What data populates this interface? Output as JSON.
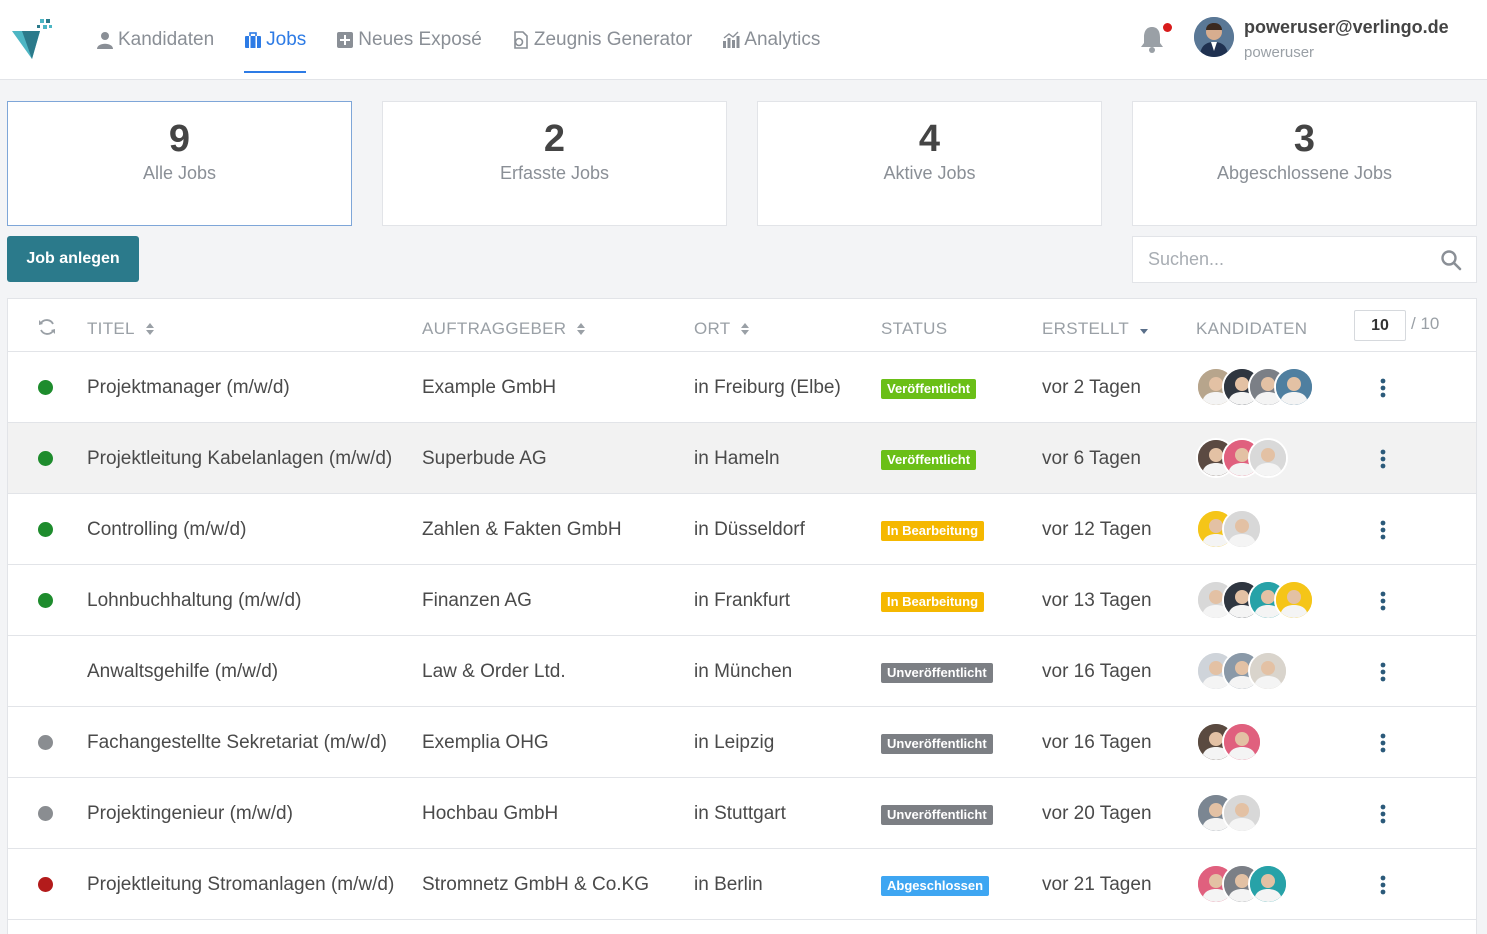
{
  "nav": {
    "items": [
      {
        "label": "Kandidaten",
        "icon": "user-icon",
        "active": false
      },
      {
        "label": "Jobs",
        "icon": "briefcase-icon",
        "active": true
      },
      {
        "label": "Neues Exposé",
        "icon": "plus-square-icon",
        "active": false
      },
      {
        "label": "Zeugnis Generator",
        "icon": "document-gear-icon",
        "active": false
      },
      {
        "label": "Analytics",
        "icon": "analytics-icon",
        "active": false
      }
    ],
    "user": {
      "email": "poweruser@verlingo.de",
      "name": "poweruser"
    }
  },
  "stats": [
    {
      "value": "9",
      "label": "Alle Jobs",
      "selected": true
    },
    {
      "value": "2",
      "label": "Erfasste Jobs",
      "selected": false
    },
    {
      "value": "4",
      "label": "Aktive Jobs",
      "selected": false
    },
    {
      "value": "3",
      "label": "Abgeschlossene Jobs",
      "selected": false
    }
  ],
  "actions": {
    "create_label": "Job anlegen",
    "search_placeholder": "Suchen..."
  },
  "table": {
    "headers": {
      "title": "TITEL",
      "client": "AUFTRAGGEBER",
      "location": "ORT",
      "status": "STATUS",
      "created": "ERSTELLT",
      "candidates": "KANDIDATEN"
    },
    "per_page": "10",
    "per_page_total": "/ 10",
    "status_colors": {
      "Veröffentlicht": "#6abf17",
      "In Bearbeitung": "#f5b800",
      "Unveröffentlicht": "#7c7f84",
      "Abgeschlossen": "#3ea6f2"
    },
    "rows": [
      {
        "dot": "#1e8c2d",
        "title": "Projektmanager (m/w/d)",
        "client": "Example GmbH",
        "location": "in Freiburg (Elbe)",
        "status": "Veröffentlicht",
        "created": "vor 2 Tagen",
        "avatars": [
          "#b7a58c",
          "#2f3640",
          "#7b7f86",
          "#4f7fa0"
        ],
        "highlight": false
      },
      {
        "dot": "#1e8c2d",
        "title": "Projektleitung Kabelanlagen (m/w/d)",
        "client": "Superbude AG",
        "location": "in Hameln",
        "status": "Veröffentlicht",
        "created": "vor 6 Tagen",
        "avatars": [
          "#5b4a42",
          "#e0607e",
          "#d9d9d9"
        ],
        "highlight": true
      },
      {
        "dot": "#1e8c2d",
        "title": "Controlling (m/w/d)",
        "client": "Zahlen & Fakten GmbH",
        "location": "in Düsseldorf",
        "status": "In Bearbeitung",
        "created": "vor 12 Tagen",
        "avatars": [
          "#f5c518",
          "#d8d8d8"
        ],
        "highlight": false
      },
      {
        "dot": "#1e8c2d",
        "title": "Lohnbuchhaltung (m/w/d)",
        "client": "Finanzen AG",
        "location": "in Frankfurt",
        "status": "In Bearbeitung",
        "created": "vor 13 Tagen",
        "avatars": [
          "#d8d8d8",
          "#2f3640",
          "#27a2a8",
          "#f5c518"
        ],
        "highlight": false
      },
      {
        "dot": "",
        "title": "Anwaltsgehilfe (m/w/d)",
        "client": "Law & Order Ltd.",
        "location": "in München",
        "status": "Unveröffentlicht",
        "created": "vor 16 Tagen",
        "avatars": [
          "#cfd4da",
          "#8a99a8",
          "#d9d4cc"
        ],
        "highlight": false
      },
      {
        "dot": "#8a8d91",
        "title": "Fachangestellte Sekretariat (m/w/d)",
        "client": "Exemplia OHG",
        "location": "in Leipzig",
        "status": "Unveröffentlicht",
        "created": "vor 16 Tagen",
        "avatars": [
          "#5a4a40",
          "#e0607e"
        ],
        "highlight": false
      },
      {
        "dot": "#8a8d91",
        "title": "Projektingenieur (m/w/d)",
        "client": "Hochbau GmbH",
        "location": "in Stuttgart",
        "status": "Unveröffentlicht",
        "created": "vor 20 Tagen",
        "avatars": [
          "#7b8692",
          "#d8d8d8"
        ],
        "highlight": false
      },
      {
        "dot": "#b31b1b",
        "title": "Projektleitung Stromanlagen (m/w/d)",
        "client": "Stromnetz GmbH & Co.KG",
        "location": "in Berlin",
        "status": "Abgeschlossen",
        "created": "vor 21 Tagen",
        "avatars": [
          "#e0607e",
          "#7b7f86",
          "#27a2a8"
        ],
        "highlight": false
      }
    ]
  }
}
